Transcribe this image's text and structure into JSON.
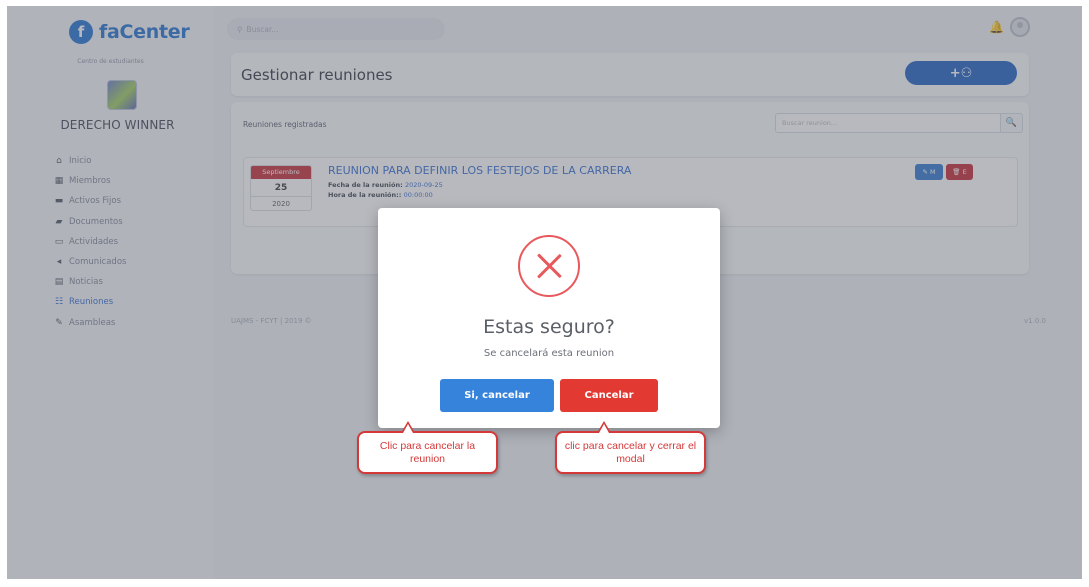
{
  "brand": {
    "logo_letter": "f",
    "name": "faCenter"
  },
  "org": {
    "subtitle": "Centro de estudiantes",
    "name": "DERECHO WINNER"
  },
  "search": {
    "placeholder": "Buscar..."
  },
  "nav": [
    {
      "label": "Inicio",
      "icon": "home-icon",
      "glyph": "⌂"
    },
    {
      "label": "Miembros",
      "icon": "members-icon",
      "glyph": "▦"
    },
    {
      "label": "Activos Fijos",
      "icon": "assets-icon",
      "glyph": "▬"
    },
    {
      "label": "Documentos",
      "icon": "folder-icon",
      "glyph": "▰"
    },
    {
      "label": "Actividades",
      "icon": "activities-icon",
      "glyph": "▭"
    },
    {
      "label": "Comunicados",
      "icon": "announce-icon",
      "glyph": "◂"
    },
    {
      "label": "Noticias",
      "icon": "news-icon",
      "glyph": "▤"
    },
    {
      "label": "Reuniones",
      "icon": "meetings-icon",
      "glyph": "☷",
      "active": true
    },
    {
      "label": "Asambleas",
      "icon": "gavel-icon",
      "glyph": "✎"
    }
  ],
  "header": {
    "title": "Gestionar reuniones",
    "add_label": "+⚇"
  },
  "list": {
    "subtitle": "Reuniones registradas",
    "filter_placeholder": "Buscar reunion...",
    "filter_icon": "🔍"
  },
  "meeting": {
    "month": "Septiembre",
    "day": "25",
    "year": "2020",
    "title": "REUNION PARA DEFINIR LOS FESTEJOS DE LA CARRERA",
    "date_label": "Fecha de la reunión:",
    "date_value": "2020-09-25",
    "time_label": "Hora de la reunión::",
    "time_value": "00:00:00",
    "edit_label": "✎ M",
    "delete_label": "🗑 E"
  },
  "footer": {
    "left": "UAJMS - FCYT | 2019 ©",
    "right": "v1.0.0"
  },
  "modal": {
    "title": "Estas seguro?",
    "text": "Se cancelará esta reunion",
    "confirm_label": "Si, cancelar",
    "cancel_label": "Cancelar"
  },
  "callouts": {
    "confirm_note": "Clic para cancelar la reunion",
    "cancel_note": "clic para cancelar y cerrar el modal"
  },
  "colors": {
    "primary": "#1e5fc4",
    "confirm": "#3683dc",
    "danger": "#e23a33",
    "callout": "#d53838"
  }
}
